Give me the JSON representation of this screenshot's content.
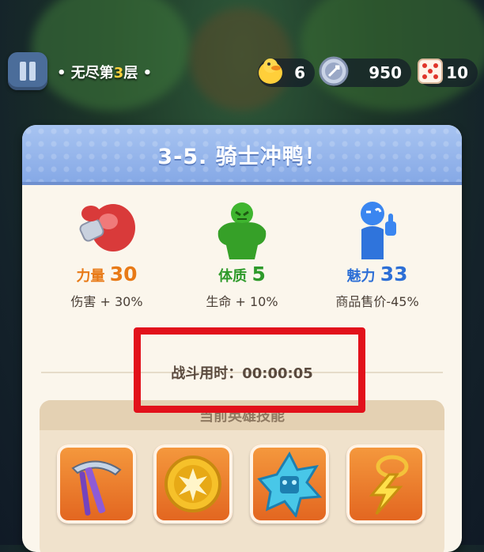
{
  "top_bar": {
    "floor_prefix": "• 无尽第",
    "floor_number": "3",
    "floor_suffix": "层 •",
    "resources": [
      {
        "icon": "duck-icon",
        "value": "6"
      },
      {
        "icon": "coin-icon",
        "value": "950"
      },
      {
        "icon": "dice-icon",
        "value": "10"
      }
    ]
  },
  "panel": {
    "title": "3-5. 骑士冲鸭！",
    "stats": [
      {
        "icon": "boxing-glove-icon",
        "name": "力量",
        "value": "30",
        "desc": "伤害 + 30%",
        "color": "#e87a17"
      },
      {
        "icon": "muscle-man-icon",
        "name": "体质",
        "value": "5",
        "desc": "生命 + 10%",
        "color": "#2e9a2a"
      },
      {
        "icon": "thumbs-up-man-icon",
        "name": "魅力",
        "value": "33",
        "desc": "商品售价-45%",
        "color": "#2d6fd6"
      }
    ],
    "battle_time_label": "战斗用时：",
    "battle_time": "00:00:05",
    "skills_label": "当前英雄技能",
    "skills": [
      {
        "icon": "pickaxe-icon"
      },
      {
        "icon": "explosion-coin-icon"
      },
      {
        "icon": "ice-star-icon"
      },
      {
        "icon": "lightning-pendant-icon"
      }
    ]
  },
  "colors": {
    "highlight_box": "#e2111b",
    "header_blue": "#86a9e6",
    "floor_number": "#ffd23c"
  }
}
